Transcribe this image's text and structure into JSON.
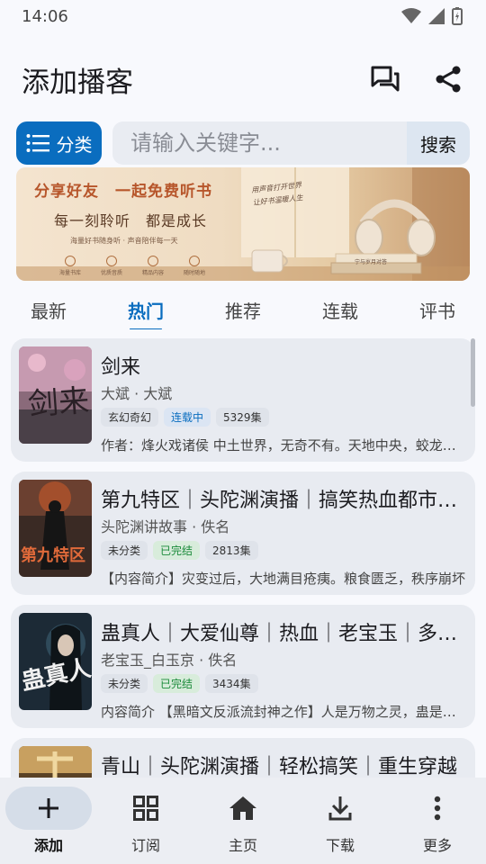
{
  "status_bar": {
    "time": "14:06"
  },
  "header": {
    "title": "添加播客"
  },
  "search": {
    "category_label": "分类",
    "placeholder": "请输入关键字...",
    "button_label": "搜索"
  },
  "banner": {
    "headline": "分享好友　一起免费听书",
    "subline": "每一刻聆听　都是成长",
    "small_text": "海量好书随身听 · 声音陪伴每一天",
    "note_line1": "用声音打开世界",
    "note_line2": "让好书温暖人生",
    "book_text": "宁与岁月对答",
    "features": [
      "海量书库",
      "优质音质",
      "精品内容",
      "随时随地"
    ]
  },
  "tabs": [
    {
      "label": "最新"
    },
    {
      "label": "热门"
    },
    {
      "label": "推荐"
    },
    {
      "label": "连载"
    },
    {
      "label": "评书"
    }
  ],
  "active_tab": "热门",
  "items": [
    {
      "title": "剑来",
      "author": "大斌 · 大斌",
      "genre": "玄幻奇幻",
      "status": "连载中",
      "episodes": "5329集",
      "desc": "作者：烽火戏诸侯 中土世界，无奇不有。天地中央，蛟龙出没",
      "cover_text": "剑来"
    },
    {
      "title": "第九特区｜头陀渊演播｜搞笑热血都市异能",
      "author": "头陀渊讲故事 · 佚名",
      "genre": "未分类",
      "status": "已完结",
      "episodes": "2813集",
      "desc": "【内容简介】灾变过后，大地满目疮痍。粮食匮乏，秩序崩坏",
      "cover_text": "第九特区"
    },
    {
      "title": "蛊真人｜大爱仙尊｜热血｜老宝玉｜多人有声剧",
      "author": "老宝玉_白玉京 · 佚名",
      "genre": "未分类",
      "status": "已完结",
      "episodes": "3434集",
      "desc": "内容简介 【黑暗文反派流封神之作】人是万物之灵，蛊是天地",
      "cover_text": "蛊真人"
    },
    {
      "title": "青山｜头陀渊演播｜轻松搞笑｜重生穿越",
      "author": "",
      "genre": "",
      "status": "",
      "episodes": "",
      "desc": "",
      "cover_text": ""
    }
  ],
  "bottom_nav": [
    {
      "label": "添加",
      "icon": "plus-icon"
    },
    {
      "label": "订阅",
      "icon": "grid-icon"
    },
    {
      "label": "主页",
      "icon": "home-icon"
    },
    {
      "label": "下载",
      "icon": "download-icon"
    },
    {
      "label": "更多",
      "icon": "more-vert-icon"
    }
  ],
  "colors": {
    "primary": "#0a6dbf",
    "background": "#f8f9fd",
    "card": "#e8ebf1"
  }
}
